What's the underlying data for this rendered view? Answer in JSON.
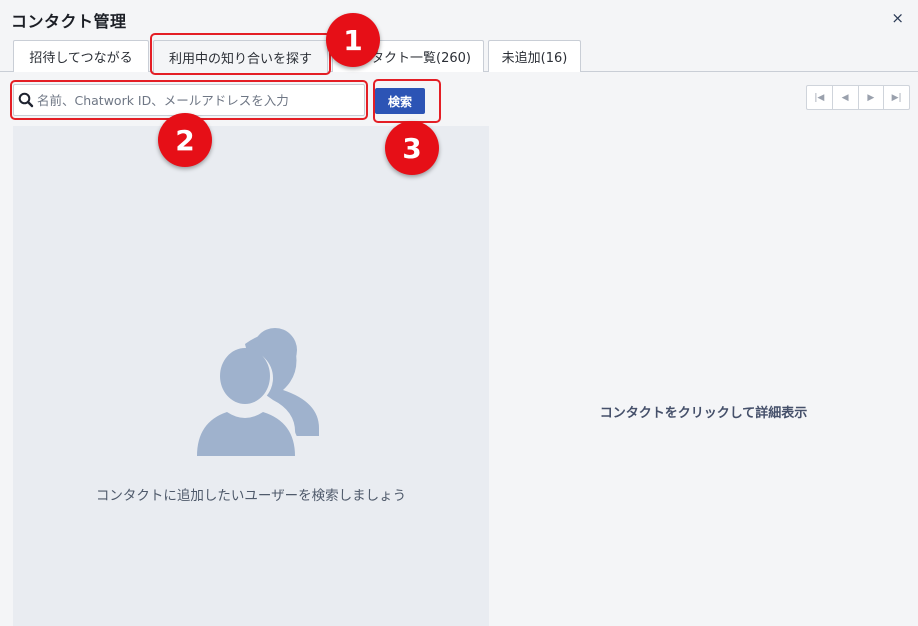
{
  "dialog": {
    "title": "コンタクト管理",
    "close_icon": "close-icon",
    "close_glyph": "×"
  },
  "tabs": [
    {
      "label": "招待してつながる"
    },
    {
      "label": "利用中の知り合いを探す"
    },
    {
      "label": "コンタクト一覧(260)"
    },
    {
      "label": "未追加(16)"
    }
  ],
  "search": {
    "placeholder": "名前、Chatwork ID、メールアドレスを入力",
    "value": "",
    "icon": "search-icon",
    "button_label": "検索"
  },
  "pager": {
    "first": "|◀",
    "prev": "◀",
    "next": "▶",
    "last": "▶|"
  },
  "left_panel": {
    "icon": "users-icon",
    "empty_message": "コンタクトに追加したいユーザーを検索しましょう"
  },
  "right_panel": {
    "detail_message": "コンタクトをクリックして詳細表示"
  },
  "annotations": {
    "badge_1": "1",
    "badge_2": "2",
    "badge_3": "3",
    "color": "#e60f17"
  }
}
